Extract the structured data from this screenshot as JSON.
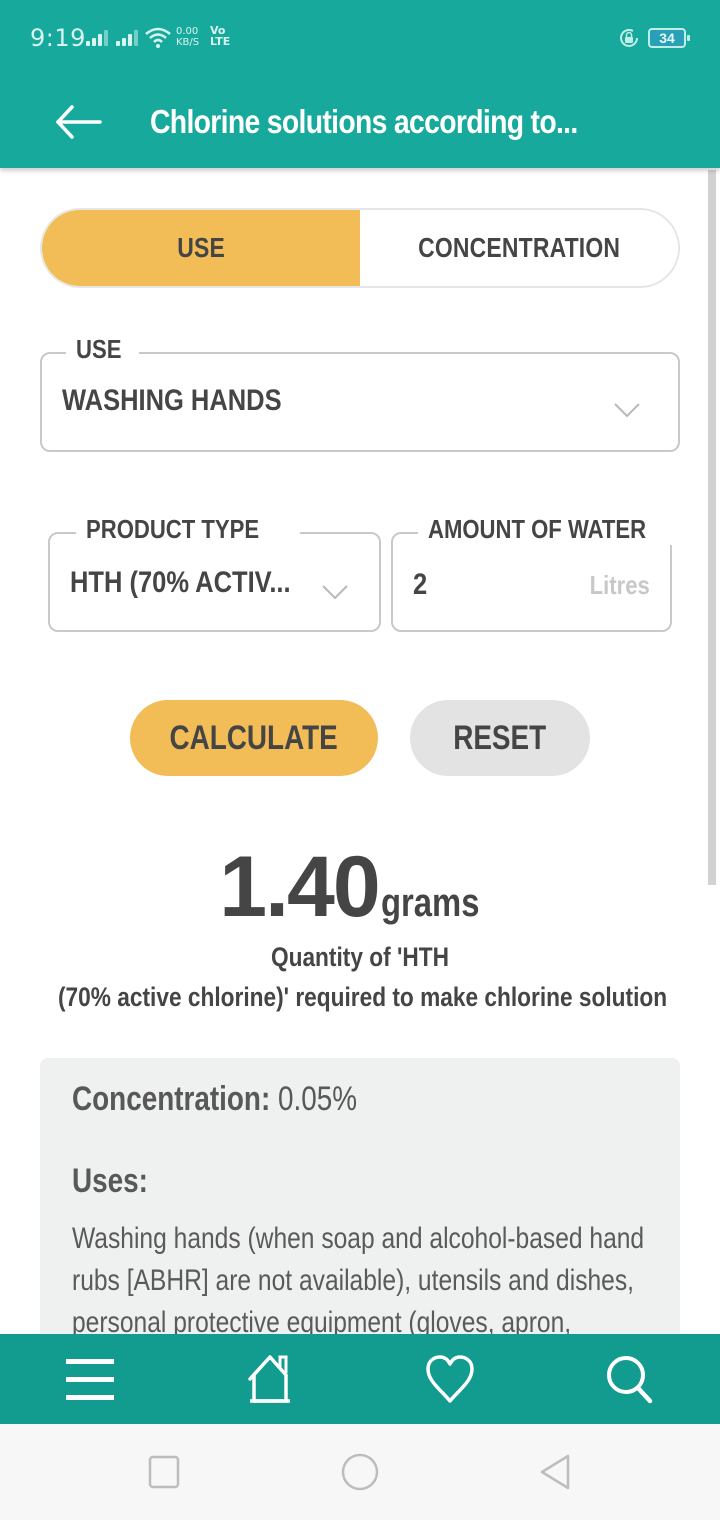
{
  "status_bar": {
    "time": "9:19",
    "net_speed_value": "0.00",
    "net_speed_unit": "KB/S",
    "volte_top": "Vo",
    "volte_bottom": "LTE",
    "battery_level": "34",
    "icons": [
      "signal-icon",
      "signal-icon",
      "wifi-icon",
      "rotate-lock-icon",
      "battery-icon"
    ]
  },
  "app_bar": {
    "back_icon": "arrow-left-icon",
    "title": "Chlorine solutions according to..."
  },
  "mode_tabs": [
    {
      "label": "USE",
      "active": true
    },
    {
      "label": "CONCENTRATION",
      "active": false
    }
  ],
  "form": {
    "use": {
      "label": "USE",
      "value": "WASHING HANDS"
    },
    "product_type": {
      "label": "PRODUCT TYPE",
      "value": "HTH  (70% ACTIV..."
    },
    "amount_of_water": {
      "label": "AMOUNT OF WATER",
      "value": "2",
      "unit": "Litres"
    }
  },
  "buttons": {
    "calculate": "CALCULATE",
    "reset": "RESET"
  },
  "result": {
    "value": "1.40",
    "unit": "grams",
    "caption_line1": "Quantity of 'HTH",
    "caption_line2": "(70% active chlorine)'  required to make chlorine solution"
  },
  "info": {
    "concentration_label": "Concentration:",
    "concentration_value": " 0.05%",
    "uses_label": "Uses:",
    "uses_text": "Washing hands (when soap and alcohol-based hand rubs [ABHR] are not available), utensils and dishes, personal protective equipment       (gloves, apron,"
  },
  "bottom_nav": [
    {
      "name": "menu",
      "icon": "menu-icon"
    },
    {
      "name": "home",
      "icon": "home-icon"
    },
    {
      "name": "favorites",
      "icon": "heart-icon"
    },
    {
      "name": "search",
      "icon": "search-icon"
    }
  ],
  "system_nav": [
    "recent-apps-icon",
    "home-circle-icon",
    "back-triangle-icon"
  ],
  "colors": {
    "primary": "#17a99c",
    "bottom_nav": "#129b8f",
    "accent": "#f2bd57",
    "text": "#454545",
    "card_bg": "#eff0f0",
    "reset_bg": "#e3e3e3"
  }
}
